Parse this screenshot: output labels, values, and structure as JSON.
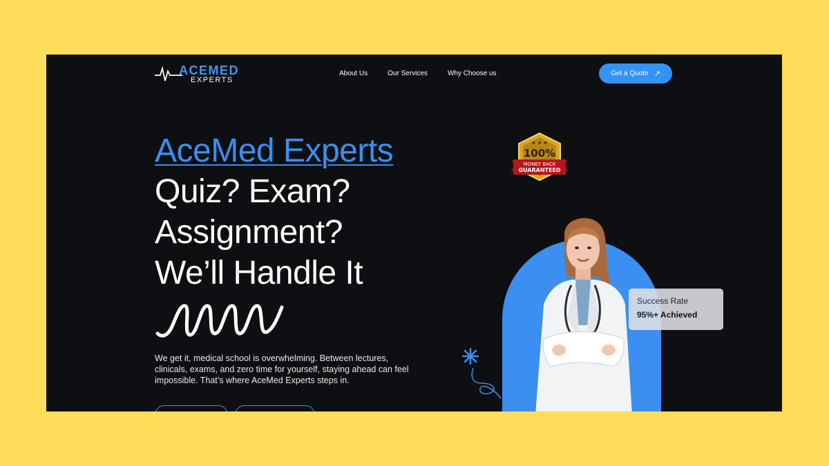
{
  "logo": {
    "top_text": "ACEMED",
    "bottom_text": "EXPERTS"
  },
  "nav": {
    "items": [
      "About Us",
      "Our Services",
      "Why Choose us"
    ]
  },
  "cta": {
    "label": "Get a Quote",
    "icon": "arrow-up-right-icon"
  },
  "hero": {
    "brand": "AceMed Experts",
    "lines": [
      "Quiz? Exam?",
      "Assignment?",
      "We’ll Handle It"
    ],
    "description": "We get it, medical school is overwhelming. Between lectures, clinicals, exams, and zero time for yourself, staying ahead can feel impossible. That’s where AceMed Experts steps in."
  },
  "badge": {
    "percent": "100%",
    "line1": "MONEY BACK",
    "line2": "GUARANTEED"
  },
  "success": {
    "title": "Success Rate",
    "value": "95%+ Achieved"
  },
  "colors": {
    "page_bg": "#FEDD5B",
    "frame_bg": "#0e0f12",
    "accent": "#3a8ff0",
    "cta": "#3592f7",
    "badge_gold": "#d9a520",
    "badge_red": "#b5161c"
  }
}
